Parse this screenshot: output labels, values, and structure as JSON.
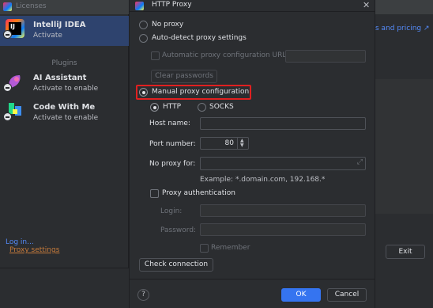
{
  "background_window": {
    "title": "Licenses",
    "products": [
      {
        "name": "IntelliJ IDEA",
        "status": "Activate",
        "icon": "intellij-idea-icon",
        "selected": true
      },
      {
        "name": "AI Assistant",
        "status": "Activate to enable",
        "icon": "ai-assistant-icon",
        "selected": false
      },
      {
        "name": "Code With Me",
        "status": "Activate to enable",
        "icon": "code-with-me-icon",
        "selected": false
      }
    ],
    "plugins_label": "Plugins",
    "login_link": "Log in...",
    "proxy_settings_link": "Proxy settings",
    "pricing_link": "s and pricing ↗",
    "exit_button": "Exit"
  },
  "dialog": {
    "title": "HTTP Proxy",
    "close_icon": "close-icon",
    "no_proxy": "No proxy",
    "auto_detect": "Auto-detect proxy settings",
    "auto_config_url": "Automatic proxy configuration URL:",
    "clear_passwords": "Clear passwords",
    "manual": "Manual proxy configuration",
    "selected_mode": "manual",
    "http": "HTTP",
    "socks": "SOCKS",
    "selected_protocol": "HTTP",
    "host_name_label": "Host name:",
    "host_name_value": "",
    "port_label": "Port number:",
    "port_value": "80",
    "no_proxy_for_label": "No proxy for:",
    "no_proxy_for_value": "",
    "example": "Example: *.domain.com, 192.168.*",
    "proxy_auth": "Proxy authentication",
    "login_label": "Login:",
    "password_label": "Password:",
    "remember": "Remember",
    "check_connection": "Check connection",
    "help": "?",
    "ok": "OK",
    "cancel": "Cancel"
  },
  "colors": {
    "accent": "#3574f0",
    "highlight": "#e02020",
    "link": "#548af7",
    "proxy_link": "#c77b3b"
  }
}
